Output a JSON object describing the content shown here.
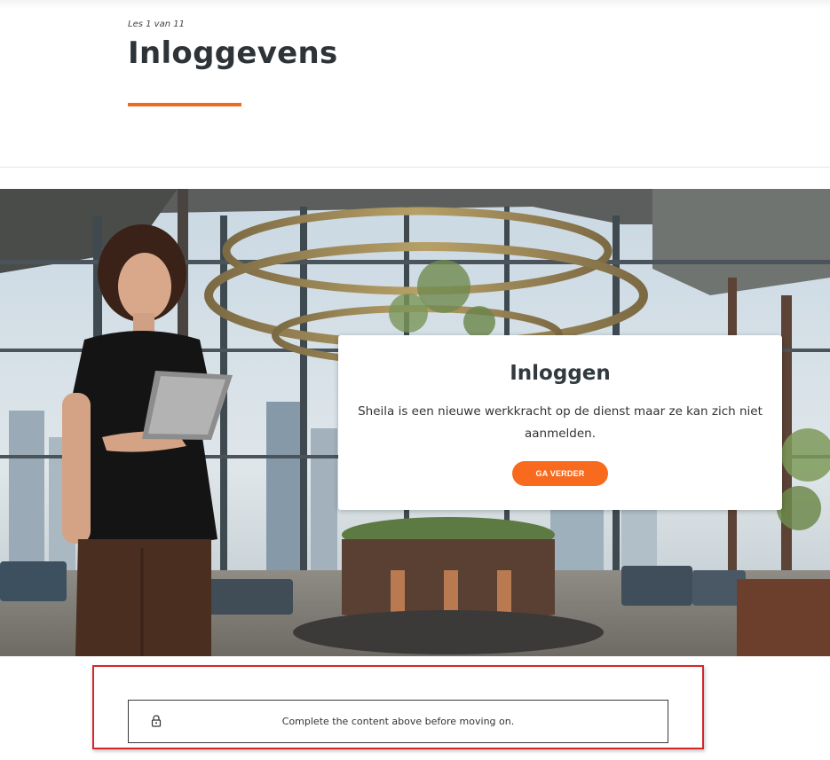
{
  "lesson": {
    "counter": "Les 1 van 11",
    "title": "Inloggevens"
  },
  "colors": {
    "accent": "#f26a21",
    "button": "#f86a1e",
    "highlight_frame": "#d7262a",
    "title_text": "#2d3337"
  },
  "hero": {
    "scene": "office-lobby-photo",
    "card": {
      "title": "Inloggen",
      "text": "Sheila is een nieuwe werkkracht op de dienst maar ze kan zich niet aanmelden.",
      "button_label": "GA VERDER"
    }
  },
  "lock_notice": {
    "icon": "lock-icon",
    "text": "Complete the content above before moving on."
  }
}
